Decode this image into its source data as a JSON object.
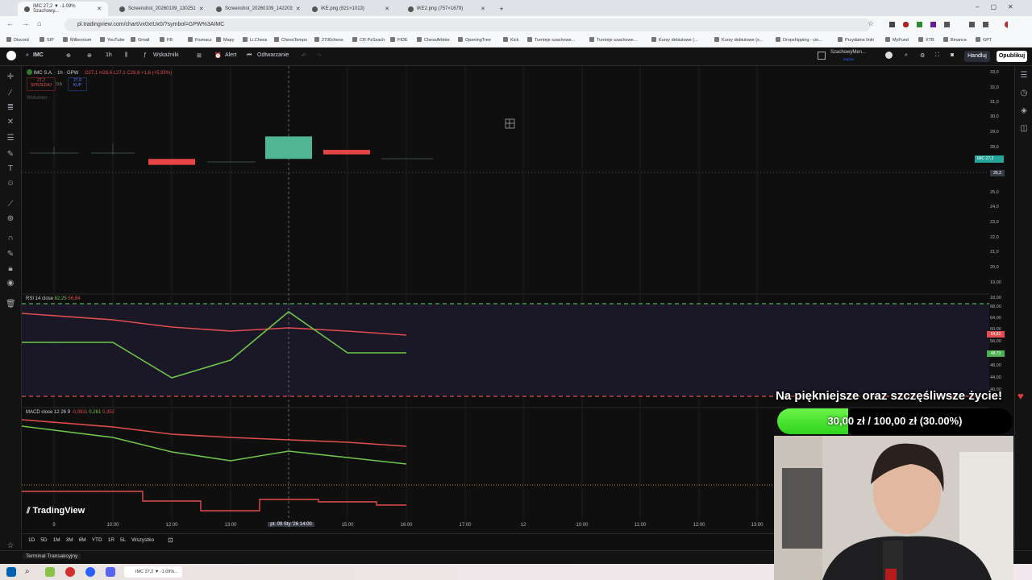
{
  "browser": {
    "tabs": [
      {
        "label": "IMC 27,2 ▼ -1.09% Szachowy..."
      },
      {
        "label": "Screenshot_20260109_130251"
      },
      {
        "label": "Screenshot_20260109_142203"
      },
      {
        "label": "IKE.png (821×1013)"
      },
      {
        "label": "IKE2.png (757×1679)"
      }
    ],
    "new_tab": "+",
    "url": "pl.tradingview.com/chart/vx0xtUx0/?symbol=GPW%3AIMC",
    "bookmarks": [
      "Discord",
      "SIP",
      "Millennium",
      "YouTube",
      "Gmail",
      "FB",
      "Fiumacz",
      "Mapy",
      "Li.Chess",
      "ChessTempo",
      "2700chess",
      "CR PzSzach",
      "FIDE",
      "ChessArbiter",
      "OpeningTree",
      "Kick",
      "Turnieje szachowe...",
      "Turnieje szachowe...",
      "Kursy debiutowe (...",
      "Kursy debiutowe (s...",
      "Dropshipping - cie...",
      "Przydatne linki",
      "MyFund",
      "XTB",
      "Binance",
      "GPT"
    ]
  },
  "toolbar": {
    "symbol": "IMC",
    "interval": "1h",
    "indicators": "Wskaźniki",
    "alert": "Alert",
    "replay": "Odtwarzanie",
    "layout_name": "SzachowyMen...",
    "layout_sub": "Zapisz",
    "trade": "Handluj",
    "publish": "Opublikuj"
  },
  "legend": {
    "title": "IMC S.A. · 1h · GPW",
    "ohlc": "O27,1 H28,6 L27,1 C28,6 +1,6 (+5,93%)",
    "sell_price": "27,2",
    "sell_label": "SPRZEDAJ",
    "spread": "0,6",
    "buy_price": "27,8",
    "buy_label": "KUP",
    "volume": "Wolumen"
  },
  "rsi_legend": {
    "name": "RSI 14 close",
    "v1": "62,25",
    "v2": "56,84"
  },
  "macd_legend": {
    "name": "MACD close 12 26 9",
    "v1": "-0,0911",
    "v2": "0,261",
    "v3": "0,352"
  },
  "price_axis": [
    "33,0",
    "32,0",
    "31,0",
    "30,0",
    "29,0",
    "28,0",
    "27,2",
    "26,3",
    "25,0",
    "24,0",
    "23,0",
    "22,0",
    "21,0",
    "20,0",
    "19,00",
    "18,00"
  ],
  "price_tag": {
    "symbol": "IMC",
    "value": "27,2"
  },
  "rsi_axis": [
    "68,00",
    "64,00",
    "60,00",
    "56,00",
    "52,00",
    "48,00",
    "44,00",
    "40,00"
  ],
  "rsi_tags": {
    "red": "54,82",
    "green": "48,73"
  },
  "time_axis": [
    "9",
    "10:00",
    "12:00",
    "13:00",
    "pt. 09 Sty '26  14:00",
    "15:00",
    "16:00",
    "17:00",
    "12",
    "10:00",
    "11:00",
    "12:00",
    "13:00"
  ],
  "bottom_ranges": [
    "1D",
    "5D",
    "1M",
    "3M",
    "6M",
    "YTD",
    "1R",
    "5L",
    "Wszystko"
  ],
  "terminal": "Terminal Transakcyjny",
  "brand": "TradingView",
  "chart_data": {
    "type": "candlestick",
    "candles": [
      {
        "o": 27.1,
        "c": 26.7,
        "label": "bear"
      },
      {
        "o": 27.1,
        "c": 28.6,
        "label": "bull"
      },
      {
        "o": 27.7,
        "c": 27.4,
        "label": "bear"
      }
    ]
  },
  "donation": {
    "title": "Na piękniejsze oraz szczęśliwsze życie!",
    "amount_text": "30,00 zł / 100,00 zł (30.00%)",
    "fraction": 0.3
  },
  "colors": {
    "bull": "#4fb593",
    "bear": "#e64545",
    "rsi_line": "#e04e4e",
    "rsi_ma": "#6fc64a",
    "donation_fill": "#3fd92a"
  },
  "taskbar": {
    "active_label": "IMC 27,2 ▼ -1.09%..."
  }
}
